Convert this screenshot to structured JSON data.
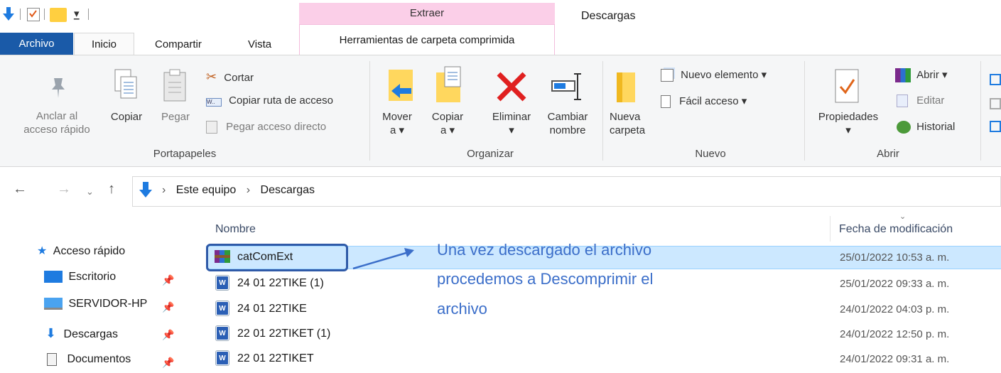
{
  "window": {
    "title": "Descargas"
  },
  "context_tab": {
    "group": "Extraer",
    "tab": "Herramientas de carpeta comprimida"
  },
  "tabs": {
    "file": "Archivo",
    "home": "Inicio",
    "share": "Compartir",
    "view": "Vista"
  },
  "ribbon": {
    "clipboard": {
      "pin_label_1": "Anclar al",
      "pin_label_2": "acceso rápido",
      "copy": "Copiar",
      "paste": "Pegar",
      "cut": "Cortar",
      "copy_path": "Copiar ruta de acceso",
      "paste_shortcut": "Pegar acceso directo",
      "group": "Portapapeles"
    },
    "organize": {
      "move_1": "Mover",
      "move_2": "a ▾",
      "copy_1": "Copiar",
      "copy_2": "a ▾",
      "delete_1": "Eliminar",
      "delete_2": "▾",
      "rename_1": "Cambiar",
      "rename_2": "nombre",
      "group": "Organizar"
    },
    "new": {
      "folder_1": "Nueva",
      "folder_2": "carpeta",
      "new_item": "Nuevo elemento ▾",
      "easy_access": "Fácil acceso ▾",
      "group": "Nuevo"
    },
    "open": {
      "properties_1": "Propiedades",
      "properties_2": "▾",
      "open": "Abrir ▾",
      "edit": "Editar",
      "history": "Historial",
      "group": "Abrir"
    }
  },
  "address": {
    "crumbs": [
      "Este equipo",
      "Descargas"
    ],
    "sep": "›"
  },
  "columns": {
    "name": "Nombre",
    "date": "Fecha de modificación"
  },
  "nav_pane": [
    {
      "label": "Acceso rápido"
    },
    {
      "label": "Escritorio"
    },
    {
      "label": "SERVIDOR-HP"
    },
    {
      "label": "Descargas"
    },
    {
      "label": "Documentos"
    }
  ],
  "files": [
    {
      "name": "catComExt",
      "date": "25/01/2022 10:53 a. m."
    },
    {
      "name": "24 01 22TIKE (1)",
      "date": "25/01/2022 09:33 a. m."
    },
    {
      "name": "24 01 22TIKE",
      "date": "24/01/2022 04:03 p. m."
    },
    {
      "name": "22 01 22TIKET (1)",
      "date": "24/01/2022 12:50 p. m."
    },
    {
      "name": "22 01 22TIKET",
      "date": "24/01/2022 09:31 a. m."
    }
  ],
  "annotation": {
    "line1": "Una vez descargado el archivo",
    "line2": "procedemos a Descomprimir el",
    "line3": "archivo"
  },
  "colors": {
    "accent": "#1a5aa8",
    "selection": "#cce8ff",
    "context": "#fbcfe8",
    "annotation": "#3b6ec9"
  }
}
